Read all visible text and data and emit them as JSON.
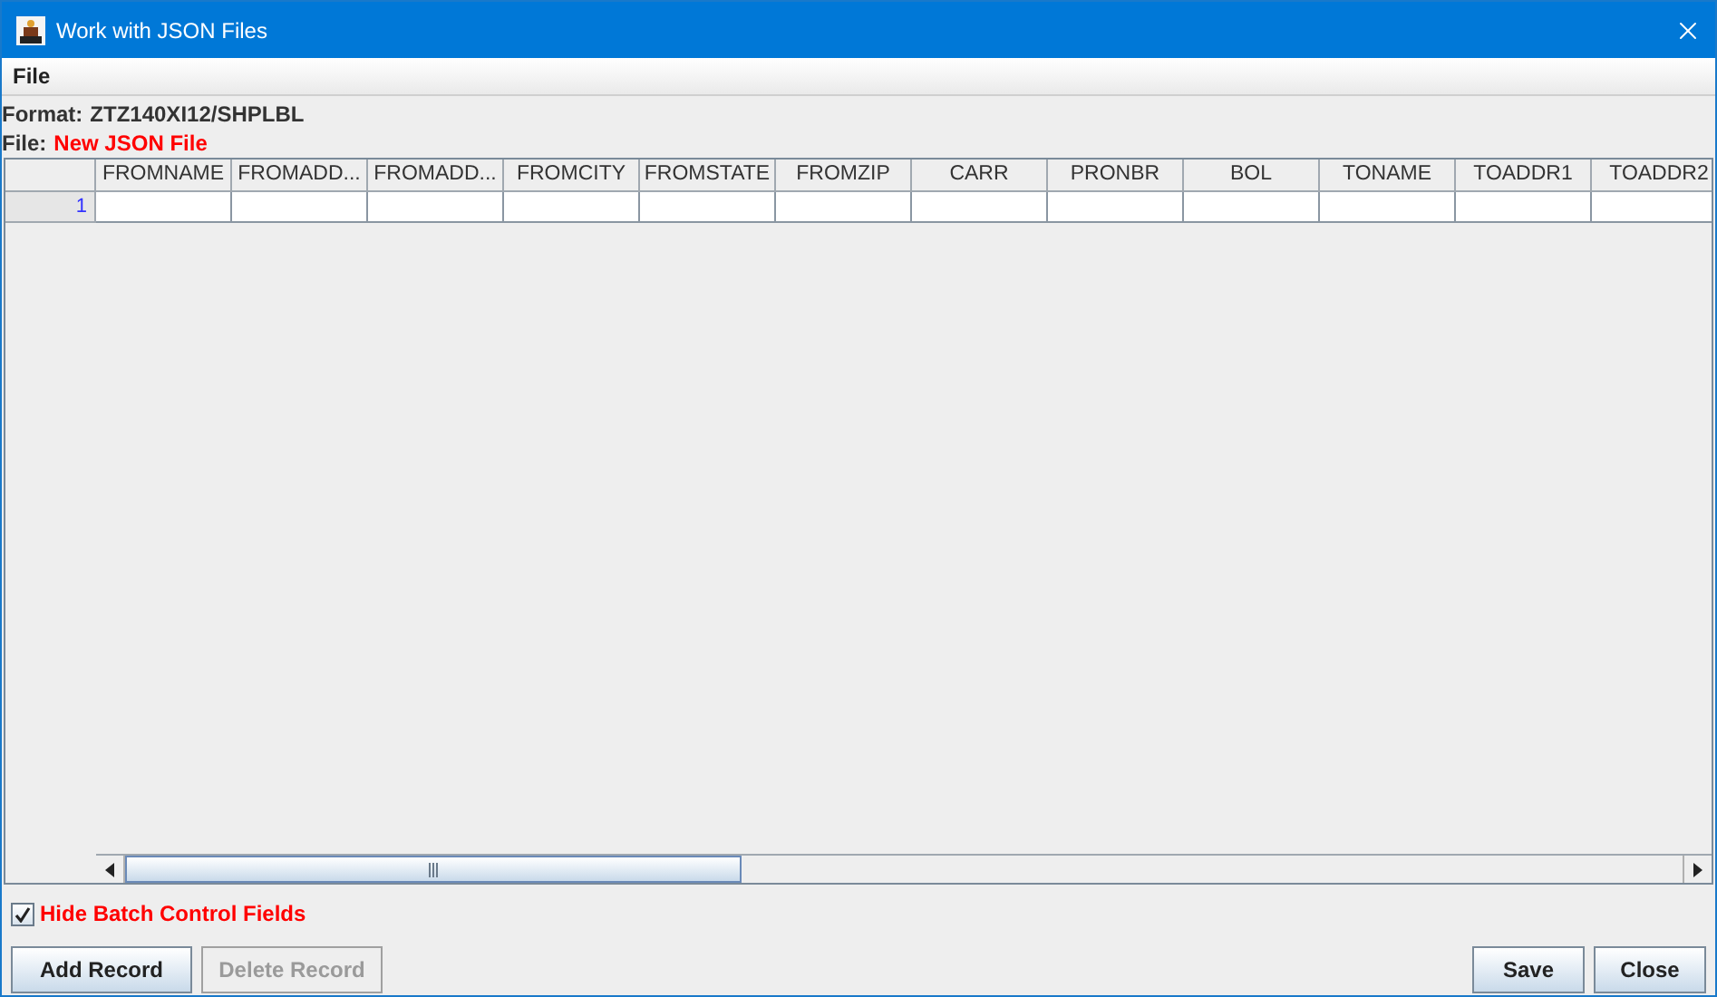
{
  "window": {
    "title": "Work with JSON Files"
  },
  "menu": [
    "File"
  ],
  "format": {
    "label": "Format:",
    "value": "ZTZ140XI12/SHPLBL"
  },
  "file": {
    "label": "File:",
    "value": "New JSON File"
  },
  "table": {
    "columns": [
      "FROMNAME",
      "FROMADD...",
      "FROMADD...",
      "FROMCITY",
      "FROMSTATE",
      "FROMZIP",
      "CARR",
      "PRONBR",
      "BOL",
      "TONAME",
      "TOADDR1",
      "TOADDR2"
    ],
    "rows": [
      {
        "row_header": "1"
      }
    ]
  },
  "hide_batch": {
    "label": "Hide Batch Control Fields",
    "checked": true
  },
  "left_buttons": [
    {
      "label": "Add Record",
      "disabled": false
    },
    {
      "label": "Delete Record",
      "disabled": true
    }
  ],
  "right_buttons": [
    {
      "label": "Save",
      "disabled": false
    },
    {
      "label": "Close",
      "disabled": false
    }
  ]
}
